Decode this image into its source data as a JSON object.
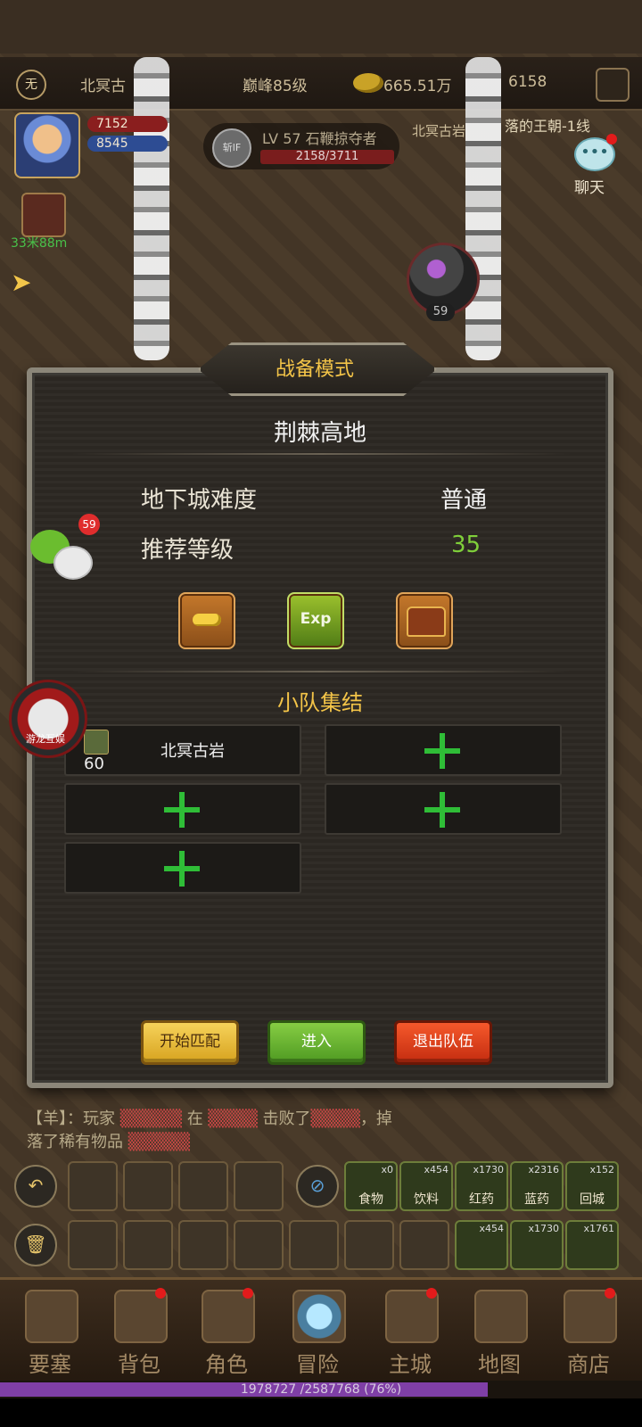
{
  "topbar": {
    "emblem": "无",
    "guild": "北冥古",
    "rank": "巅峰85级",
    "gold": "665.51万",
    "gems": "6158"
  },
  "player": {
    "hp": "7152",
    "mp": "8545",
    "distance": "33米88m"
  },
  "target": {
    "icon_text": "斩lF",
    "name": "LV 57 石鞭掠夺者",
    "hp": "2158/3711",
    "tag": "北冥古岩"
  },
  "zone": "落的王朝-1线",
  "chat_label": "聊天",
  "monster_level": "59",
  "dialog": {
    "title": "战备模式",
    "dungeon": "荆棘高地",
    "difficulty_label": "地下城难度",
    "difficulty_value": "普通",
    "level_label": "推荐等级",
    "level_value": "35",
    "rewards": [
      "gold-icon",
      "exp-icon",
      "chest-icon"
    ],
    "exp_text": "Exp",
    "team_title": "小队集结",
    "member": {
      "level": "60",
      "name": "北冥古岩"
    },
    "buttons": {
      "match": "开始匹配",
      "enter": "进入",
      "leave": "退出队伍"
    }
  },
  "wechat_badge": "59",
  "dragon_label": "游龙互娱",
  "log": {
    "line1_prefix": "【",
    "line1_tag": "羊",
    "line1_mid": "】：玩家",
    "line1_verb": "在",
    "line1_end": "击败了",
    "line1_tail": "，掉",
    "line2": "落了稀有物品"
  },
  "items": [
    {
      "count": "x0",
      "label": "食物"
    },
    {
      "count": "x454",
      "label": "饮料"
    },
    {
      "count": "x1730",
      "label": "红药"
    },
    {
      "count": "x2316",
      "label": "蓝药"
    },
    {
      "count": "x152",
      "label": "回城"
    }
  ],
  "items2": [
    {
      "count": "x454",
      "label": ""
    },
    {
      "count": "x1730",
      "label": ""
    },
    {
      "count": "x1761",
      "label": ""
    }
  ],
  "nav": [
    "要塞",
    "背包",
    "角色",
    "冒险",
    "主城",
    "地图",
    "商店"
  ],
  "exp": {
    "text": "1978727 /2587768 (76%)",
    "fraction": 0.76
  }
}
